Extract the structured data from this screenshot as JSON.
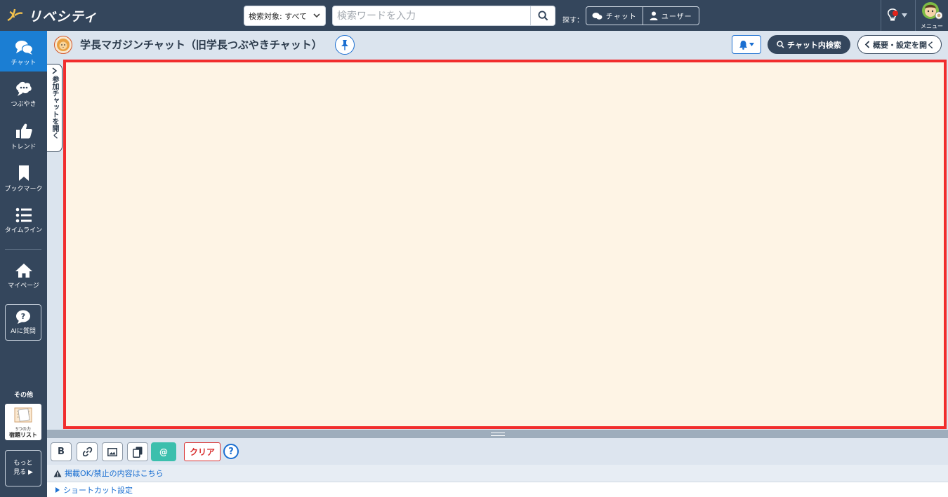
{
  "header": {
    "logo_text": "リベシティ",
    "scope_select": {
      "value": "検索対象: すべて"
    },
    "search": {
      "placeholder": "検索ワードを入力"
    },
    "find_label": "探す：",
    "find_chat_label": "チャット",
    "find_user_label": "ユーザー",
    "menu_label": "メニュー"
  },
  "sidebar": {
    "items": [
      {
        "label": "チャット",
        "icon": "chat-bubbles-icon"
      },
      {
        "label": "つぶやき",
        "icon": "speech-cloud-icon"
      },
      {
        "label": "トレンド",
        "icon": "thumbs-up-icon"
      },
      {
        "label": "ブックマーク",
        "icon": "bookmark-icon"
      },
      {
        "label": "タイムライン",
        "icon": "list-icon"
      },
      {
        "label": "マイページ",
        "icon": "home-icon"
      }
    ],
    "ai_label": "AIに質問",
    "other_label": "その他",
    "task_card": {
      "line1": "5つの力",
      "line2": "宿題リスト"
    },
    "more": {
      "line1": "もっと",
      "line2": "見る ▶"
    }
  },
  "chat": {
    "title": "学長マガジンチャット（旧学長つぶやきチャット）",
    "search_label": "チャット内検索",
    "overview_label": "概要・設定を開く",
    "participant_tab_label": "参加チャットを開く"
  },
  "composer": {
    "bold_label": "B",
    "mention_label": "@",
    "clear_label": "クリア",
    "help_label": "?",
    "notice_text": "掲載OK/禁止の内容はこちら",
    "shortcut_text": "ショートカット設定"
  },
  "colors": {
    "nav_bg": "#34465c",
    "active_blue": "#1b7ed3",
    "message_bg": "#fef4e5",
    "highlight_border": "#f12d2d",
    "mention_teal": "#3bbfad"
  }
}
